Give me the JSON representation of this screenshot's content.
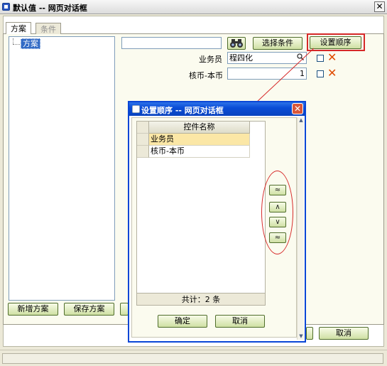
{
  "main_window": {
    "title": "默认值 -- 网页对话框",
    "close_glyph": "✕",
    "tabs": [
      {
        "label": "方案",
        "active": true
      },
      {
        "label": "条件",
        "active": false
      }
    ],
    "tree": {
      "root_label": "方案"
    },
    "search_input_value": "",
    "binoculars_icon": "binoculars-icon",
    "buttons": {
      "select_condition": "选择条件",
      "set_order": "设置顺序",
      "add_scheme": "新增方案",
      "save_scheme": "保存方案",
      "cancel": "取消"
    },
    "fields": [
      {
        "label": "业务员",
        "value": "程四化",
        "icon": "search-icon",
        "x_glyph": "✕"
      },
      {
        "label": "核币-本币",
        "value": "1",
        "x_glyph": "✕"
      }
    ]
  },
  "dialog": {
    "title": "设置顺序 -- 网页对话框",
    "close_glyph": "✕",
    "grid": {
      "header": "控件名称",
      "rows": [
        "业务员",
        "核币-本币"
      ],
      "footer": "共计：2 条"
    },
    "order_buttons": {
      "top": "≈",
      "up": "∧",
      "down": "∨",
      "bottom": "≈"
    },
    "buttons": {
      "ok": "确定",
      "cancel": "取消"
    }
  },
  "colors": {
    "accent_red": "#d62828",
    "dialog_title_blue": "#0a4cd6",
    "selected_row": "#fbe7a6",
    "tree_selection": "#316ac5"
  }
}
